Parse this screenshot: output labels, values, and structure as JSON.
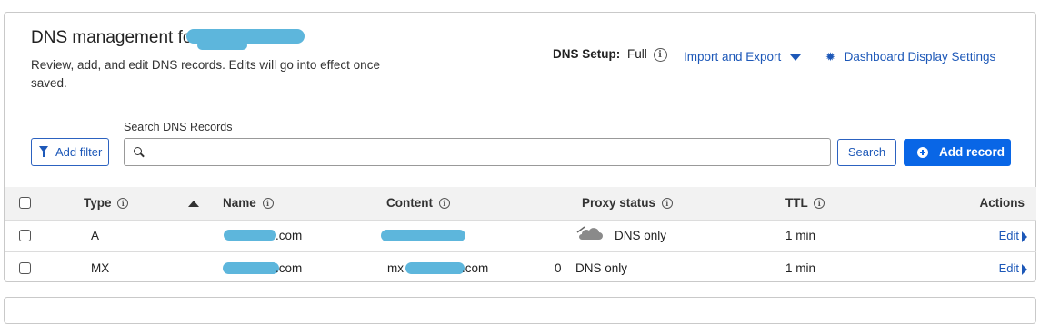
{
  "header": {
    "title": "DNS management for",
    "description": "Review, add, and edit DNS records. Edits will go into effect once saved.",
    "dns_setup_label": "DNS Setup:",
    "dns_setup_value": "Full",
    "import_export": "Import and Export",
    "dashboard_settings": "Dashboard Display Settings"
  },
  "search": {
    "label": "Search DNS Records",
    "placeholder": "",
    "add_filter": "Add filter",
    "search_button": "Search",
    "add_record": "Add record"
  },
  "table": {
    "columns": {
      "type": "Type",
      "name": "Name",
      "content": "Content",
      "proxy": "Proxy status",
      "ttl": "TTL",
      "actions": "Actions"
    },
    "rows": [
      {
        "type": "A",
        "name_suffix": ".com",
        "content": "",
        "priority": "",
        "proxy": "DNS only",
        "ttl": "1 min",
        "action": "Edit"
      },
      {
        "type": "MX",
        "name_suffix": ".com",
        "content_prefix": "mx",
        "content_suffix": ".com",
        "priority": "0",
        "proxy": "DNS only",
        "ttl": "1 min",
        "action": "Edit"
      }
    ]
  },
  "icons": {
    "info": "info-circle-icon",
    "caret": "caret-down-icon",
    "gear": "gear-icon",
    "filter": "filter-icon",
    "search": "search-icon",
    "add": "plus-circle-icon",
    "sort": "sort-ascending-icon",
    "cloud": "cloud-icon",
    "edit_arrow": "caret-right-icon"
  },
  "colors": {
    "accent": "#1d58b8",
    "primary_button": "#0966e6",
    "redaction": "#5db6dc",
    "header_bg": "#f2f2f2"
  }
}
